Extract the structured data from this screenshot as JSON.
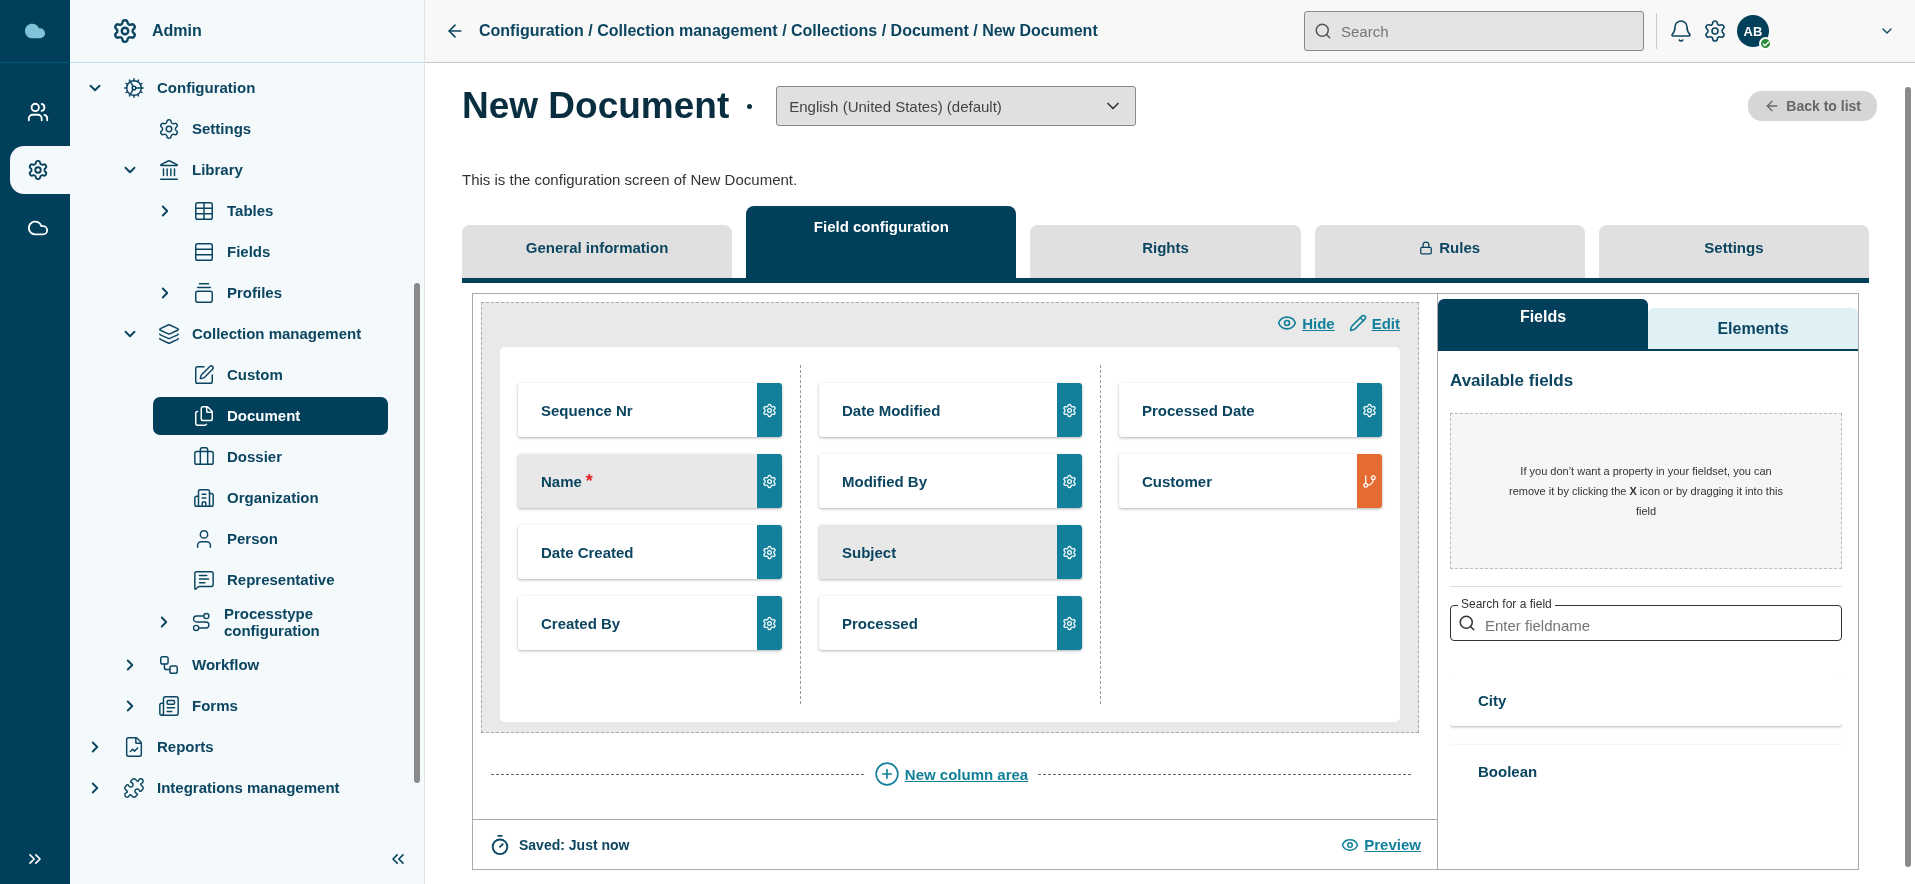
{
  "rail": {
    "items": [
      {
        "selected": false
      },
      {
        "selected": true
      },
      {
        "selected": false
      }
    ]
  },
  "sidebar": {
    "header": "Admin",
    "tree": [
      {
        "label": "Configuration",
        "kind": "group",
        "expanded": true,
        "selected": false,
        "children": [
          {
            "label": "Settings",
            "kind": "leaf",
            "selected": false
          },
          {
            "label": "Library",
            "kind": "group",
            "expanded": true,
            "selected": false,
            "children": [
              {
                "label": "Tables",
                "kind": "group",
                "expanded": false,
                "selected": false
              },
              {
                "label": "Fields",
                "kind": "leaf",
                "selected": false
              },
              {
                "label": "Profiles",
                "kind": "group",
                "expanded": false,
                "selected": false
              }
            ]
          },
          {
            "label": "Collection management",
            "kind": "group",
            "expanded": true,
            "selected": false,
            "children": [
              {
                "label": "Custom",
                "kind": "leaf",
                "selected": false
              },
              {
                "label": "Document",
                "kind": "leaf",
                "selected": true
              },
              {
                "label": "Dossier",
                "kind": "leaf",
                "selected": false
              },
              {
                "label": "Organization",
                "kind": "leaf",
                "selected": false
              },
              {
                "label": "Person",
                "kind": "leaf",
                "selected": false
              },
              {
                "label": "Representative",
                "kind": "leaf",
                "selected": false
              },
              {
                "label": "Processtype configuration",
                "kind": "group",
                "expanded": false,
                "selected": false
              }
            ]
          },
          {
            "label": "Workflow",
            "kind": "group",
            "expanded": false,
            "selected": false
          },
          {
            "label": "Forms",
            "kind": "group",
            "expanded": false,
            "selected": false
          }
        ]
      },
      {
        "label": "Reports",
        "kind": "group",
        "expanded": false,
        "selected": false
      },
      {
        "label": "Integrations management",
        "kind": "group",
        "expanded": false,
        "selected": false
      }
    ]
  },
  "topbar": {
    "breadcrumb": "Configuration / Collection management / Collections / Document / New Document",
    "search": {
      "placeholder": "Search"
    },
    "avatar": {
      "initials": "AB",
      "online": true
    }
  },
  "page": {
    "title": "New Document",
    "language": "English (United States) (default)",
    "back_button": {
      "label": "Back to list",
      "disabled": true
    },
    "description": "This is the configuration screen of New Document."
  },
  "tabs": [
    {
      "label": "General information",
      "selected": false,
      "locked": false
    },
    {
      "label": "Field configuration",
      "selected": true,
      "locked": false
    },
    {
      "label": "Rights",
      "selected": false,
      "locked": false
    },
    {
      "label": "Rules",
      "selected": false,
      "locked": true
    },
    {
      "label": "Settings",
      "selected": false,
      "locked": false
    }
  ],
  "canvas": {
    "hide_link": "Hide",
    "edit_link": "Edit",
    "columns": [
      [
        {
          "label": "Sequence Nr",
          "kind": "field",
          "required": false,
          "selected": false
        },
        {
          "label": "Name",
          "kind": "field",
          "required": true,
          "selected": true
        },
        {
          "label": "Date Created",
          "kind": "field",
          "required": false,
          "selected": false
        },
        {
          "label": "Created By",
          "kind": "field",
          "required": false,
          "selected": false
        }
      ],
      [
        {
          "label": "Date Modified",
          "kind": "field",
          "required": false,
          "selected": false
        },
        {
          "label": "Modified By",
          "kind": "field",
          "required": false,
          "selected": false
        },
        {
          "label": "Subject",
          "kind": "field",
          "required": false,
          "selected": true
        },
        {
          "label": "Processed",
          "kind": "field",
          "required": false,
          "selected": false
        }
      ],
      [
        {
          "label": "Processed Date",
          "kind": "field",
          "required": false,
          "selected": false
        },
        {
          "label": "Customer",
          "kind": "relation",
          "required": false,
          "selected": false
        }
      ]
    ],
    "required_mark": "*",
    "new_column": "New column area",
    "status": "Saved: Just now",
    "preview_link": "Preview"
  },
  "panel": {
    "tabs": [
      {
        "label": "Fields",
        "selected": true
      },
      {
        "label": "Elements",
        "selected": false
      }
    ],
    "heading": "Available fields",
    "dropzone": "If you don’t want a property in your fieldset, you can remove it by clicking the **X** icon or by dragging it into this field",
    "search": {
      "label": "Search for a field",
      "placeholder": "Enter fieldname"
    },
    "fields": [
      "City",
      "Boolean"
    ]
  }
}
